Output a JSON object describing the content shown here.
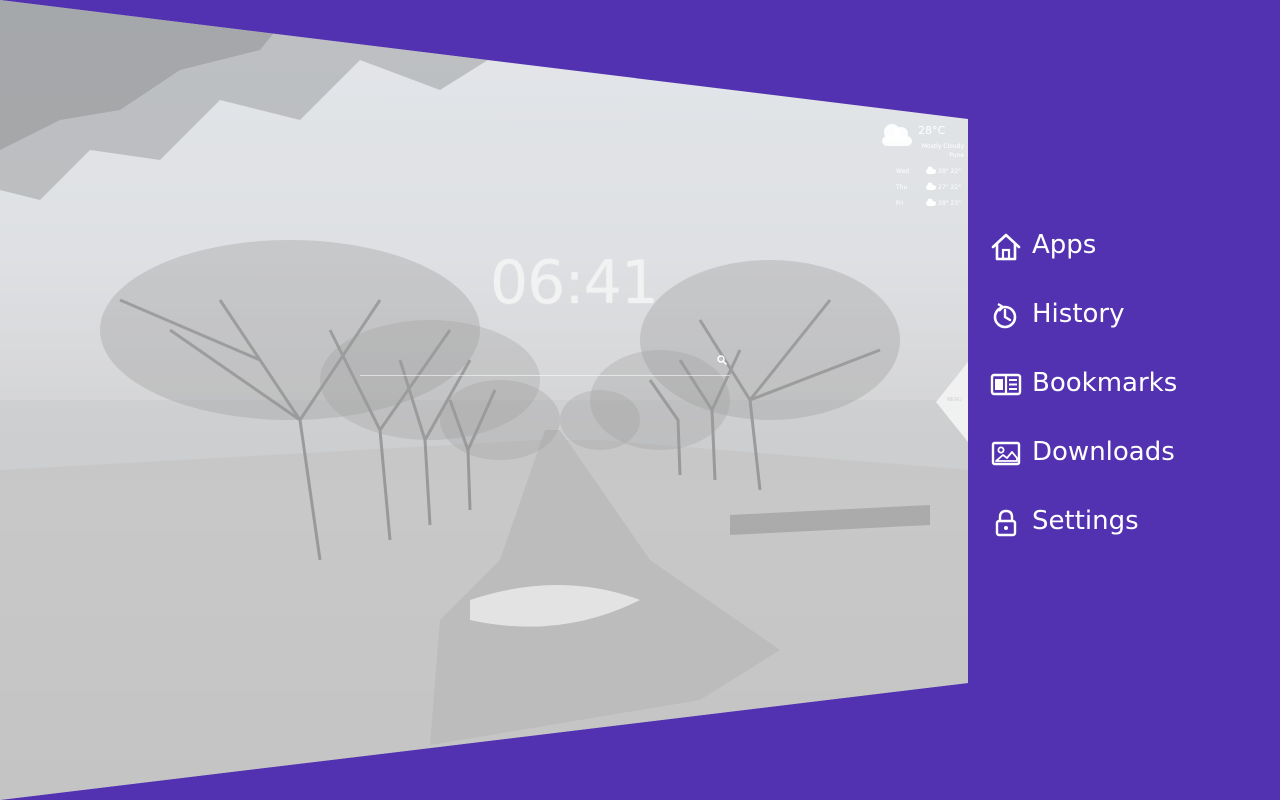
{
  "new_tab": {
    "clock": "06:41",
    "search": {
      "placeholder": ""
    },
    "weather": {
      "temperature": "28°C",
      "condition": "Mostly Cloudy\nPune",
      "forecast": [
        {
          "day": "Wed",
          "icon": "cloud-icon",
          "temps": "28° 22°"
        },
        {
          "day": "Thu",
          "icon": "cloud-icon",
          "temps": "27° 22°"
        },
        {
          "day": "Fri",
          "icon": "cloud-icon",
          "temps": "28° 23°"
        }
      ]
    },
    "edge_tab_label": "MENU"
  },
  "menu": {
    "items": [
      {
        "label": "Apps",
        "icon": "house-icon"
      },
      {
        "label": "History",
        "icon": "history-icon"
      },
      {
        "label": "Bookmarks",
        "icon": "bookmarks-icon"
      },
      {
        "label": "Downloads",
        "icon": "image-icon"
      },
      {
        "label": "Settings",
        "icon": "lock-icon"
      }
    ]
  },
  "colors": {
    "background": "#5232b0",
    "menu_text": "#ffffff"
  }
}
